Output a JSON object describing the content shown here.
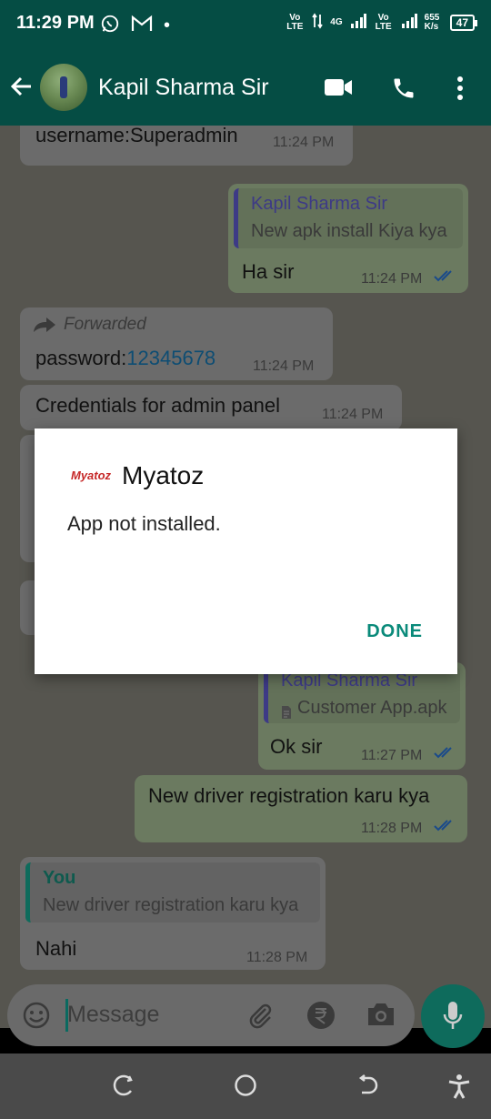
{
  "status_bar": {
    "time": "11:29 PM",
    "dot": "•",
    "vo_lte_1": "Vo LTE",
    "net_4g": "4G",
    "vo_lte_2": "Vo LTE",
    "speed": "655 K/s",
    "battery": "47"
  },
  "header": {
    "contact_name": "Kapil Sharma Sir"
  },
  "messages": {
    "m1": {
      "text": "username:Superadmin",
      "time": "11:24 PM"
    },
    "m2": {
      "quote_name": "Kapil Sharma Sir",
      "quote_text": "New apk install Kiya kya",
      "text": "Ha sir",
      "time": "11:24 PM"
    },
    "m3": {
      "forwarded": "Forwarded",
      "text_prefix": "password:",
      "text_link": "12345678",
      "time": "11:24 PM"
    },
    "m4": {
      "text": "Credentials for admin panel",
      "time": "11:24 PM"
    },
    "m5": {
      "quote_name": "Kapil Sharma Sir",
      "quote_text": "Customer App.apk",
      "text": "Ok sir",
      "time": "11:27 PM"
    },
    "m6": {
      "text": "New driver registration karu kya",
      "time": "11:28 PM"
    },
    "m7": {
      "quote_name": "You",
      "quote_text": "New driver registration karu kya",
      "text": "Nahi",
      "time": "11:28 PM"
    }
  },
  "dialog": {
    "logo_text": "Myatoz",
    "title": "Myatoz",
    "message": "App not installed.",
    "done_label": "DONE"
  },
  "input": {
    "placeholder": "Message"
  },
  "colors": {
    "header_bg": "#054d44",
    "accent": "#0a8a7a",
    "mic_bg": "#0e6b5c"
  }
}
